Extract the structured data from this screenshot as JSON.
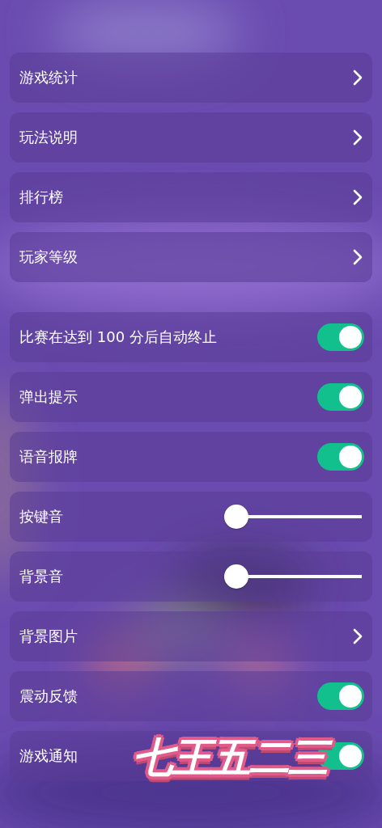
{
  "groups": [
    {
      "items": [
        {
          "kind": "link",
          "label": "游戏统计"
        },
        {
          "kind": "link",
          "label": "玩法说明"
        },
        {
          "kind": "link",
          "label": "排行榜"
        },
        {
          "kind": "link",
          "label": "玩家等级"
        }
      ]
    },
    {
      "items": [
        {
          "kind": "toggle",
          "label": "比赛在达到 100 分后自动终止",
          "on": true
        },
        {
          "kind": "toggle",
          "label": "弹出提示",
          "on": true
        },
        {
          "kind": "toggle",
          "label": "语音报牌",
          "on": true
        },
        {
          "kind": "slider",
          "label": "按键音",
          "level": 0.08
        },
        {
          "kind": "slider",
          "label": "背景音",
          "level": 0.08
        },
        {
          "kind": "link",
          "label": "背景图片"
        },
        {
          "kind": "toggle",
          "label": "震动反馈",
          "on": true
        },
        {
          "kind": "toggle",
          "label": "游戏通知",
          "on": true
        }
      ]
    }
  ],
  "logo": "七王五二三"
}
